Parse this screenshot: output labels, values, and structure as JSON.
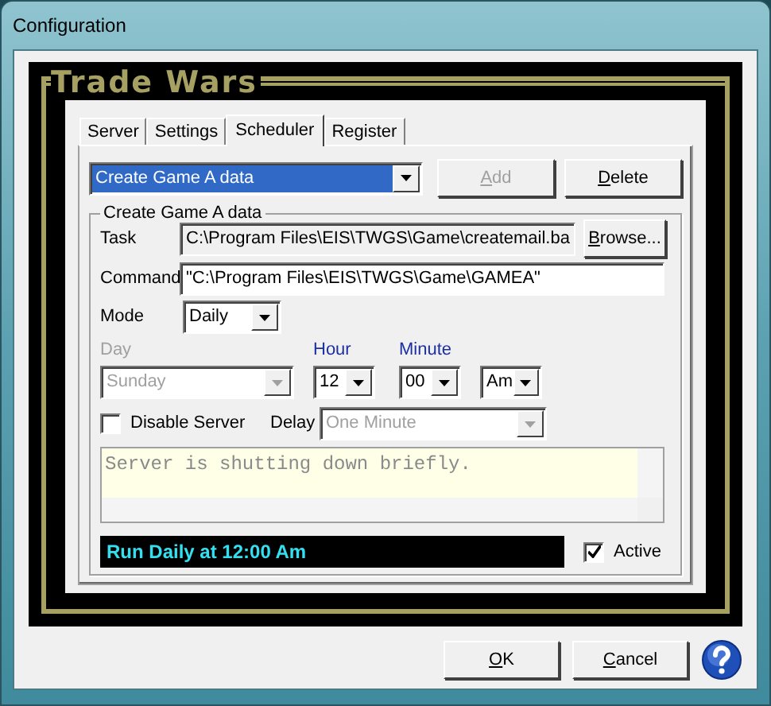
{
  "window": {
    "title": "Configuration"
  },
  "logo": "Trade Wars",
  "tabs": [
    {
      "label": "Server",
      "selected": false
    },
    {
      "label": "Settings",
      "selected": false
    },
    {
      "label": "Scheduler",
      "selected": true
    },
    {
      "label": "Register",
      "selected": false
    }
  ],
  "task_selector": {
    "value": "Create Game A data",
    "highlighted": true
  },
  "task_buttons": [
    {
      "label": "Add",
      "underline_first": true,
      "disabled": true
    },
    {
      "label": "Delete",
      "underline_first": true,
      "disabled": false
    }
  ],
  "group": {
    "caption": "Create Game A data",
    "task": {
      "label": "Task",
      "value": "C:\\Program Files\\EIS\\TWGS\\Game\\createmail.ba",
      "button": {
        "label": "Browse...",
        "underline_first": true
      }
    },
    "command": {
      "label": "Command",
      "value": "\"C:\\Program Files\\EIS\\TWGS\\Game\\GAMEA\""
    },
    "mode": {
      "label": "Mode",
      "value": "Daily"
    },
    "day": {
      "label": "Day",
      "value": "Sunday",
      "disabled": true
    },
    "hour": {
      "label": "Hour",
      "value": "12"
    },
    "minute": {
      "label": "Minute",
      "value": "00"
    },
    "ampm": {
      "value": "Am"
    },
    "disable_server": {
      "label": "Disable Server",
      "checked": false
    },
    "delay": {
      "label": "Delay",
      "value": "One Minute",
      "disabled": true
    },
    "message": {
      "value": "Server is shutting down briefly."
    },
    "summary": "Run Daily at 12:00 Am",
    "active": {
      "label": "Active",
      "checked": true
    }
  },
  "buttons": [
    {
      "label": "OK",
      "underline_first": true
    },
    {
      "label": "Cancel",
      "underline_first": true
    }
  ]
}
